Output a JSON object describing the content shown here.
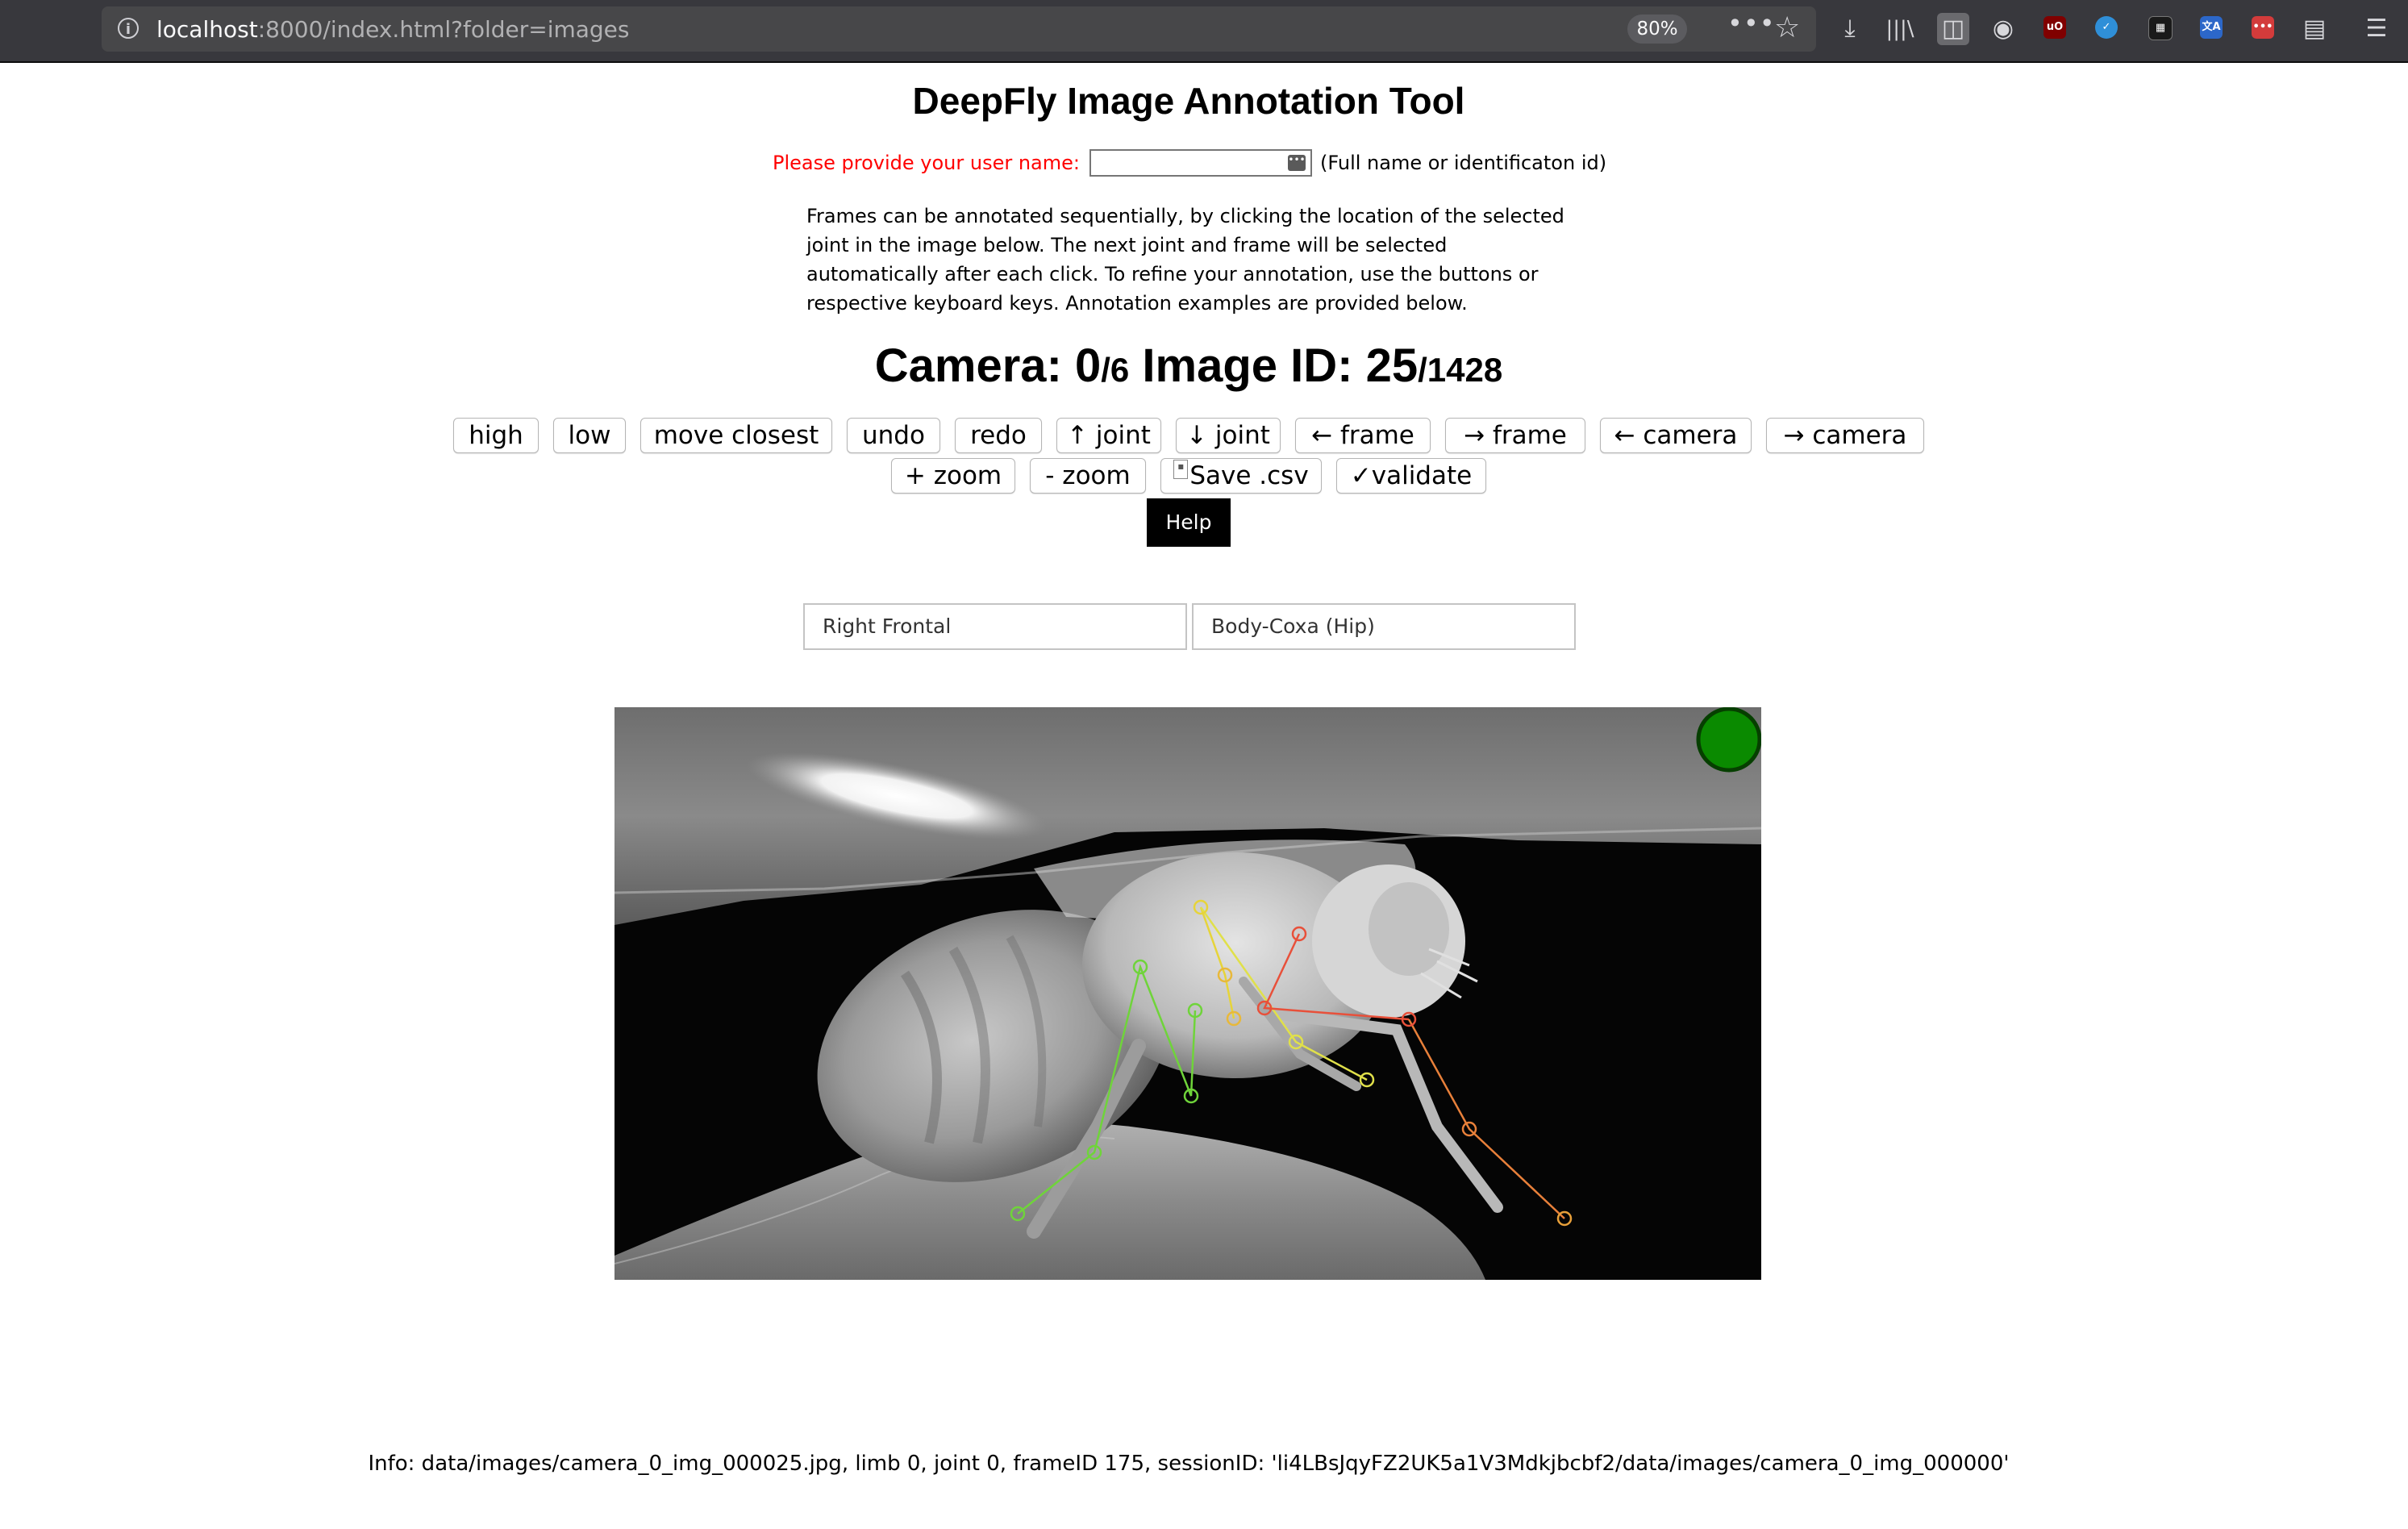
{
  "browser": {
    "url_host": "localhost",
    "url_rest": ":8000/index.html?folder=images",
    "zoom": "80%",
    "info_icon": "info-icon",
    "menu_dots": "•••",
    "star_icon": "star-icon",
    "toolbar_icons": [
      "download-icon",
      "library-icon",
      "sidebar-icon",
      "account-icon",
      "ublock-icon",
      "extension-blue-icon",
      "extension-dark-icon",
      "translate-icon",
      "extension-red-icon",
      "reader-icon",
      "hamburger-menu-icon"
    ]
  },
  "page": {
    "title": "DeepFly Image Annotation Tool",
    "user_prompt": "Please provide your user name:",
    "user_value": "",
    "user_hint": "(Full name or identificaton id)",
    "description": "Frames can be annotated sequentially, by clicking the location of the selected joint in the image below. The next joint and frame will be selected automatically after each click. To refine your annotation, use the buttons or respective keyboard keys. Annotation examples are provided below."
  },
  "header": {
    "camera_label": "Camera: ",
    "camera_index": "0",
    "camera_total": "/6",
    "image_label": " Image ID: ",
    "image_index": "25",
    "image_total": "/1428"
  },
  "buttons_row1": [
    "high",
    "low",
    "move closest",
    "undo",
    "redo",
    "↑ joint",
    "↓ joint",
    "← frame",
    "→ frame",
    "← camera",
    "→ camera"
  ],
  "buttons_row2": {
    "zoom_in": "+ zoom",
    "zoom_out": "- zoom",
    "save": "Save .csv",
    "validate": "✓validate"
  },
  "help_label": "Help",
  "selection": {
    "limb": "Right Frontal",
    "joint": "Body-Coxa (Hip)"
  },
  "colors": {
    "green_leg": "#6fd43a",
    "yellow_leg": "#e6d43a",
    "orange_leg": "#e8a03a",
    "red_leg": "#e8503a",
    "status_dot": "#0a8a00",
    "prompt_red": "#ff0000"
  },
  "info": "Info: data/images/camera_0_img_000025.jpg, limb 0, joint 0, frameID 175, sessionID: 'li4LBsJqyFZ2UK5a1V3Mdkjbcbf2/data/images/camera_0_img_000000'"
}
